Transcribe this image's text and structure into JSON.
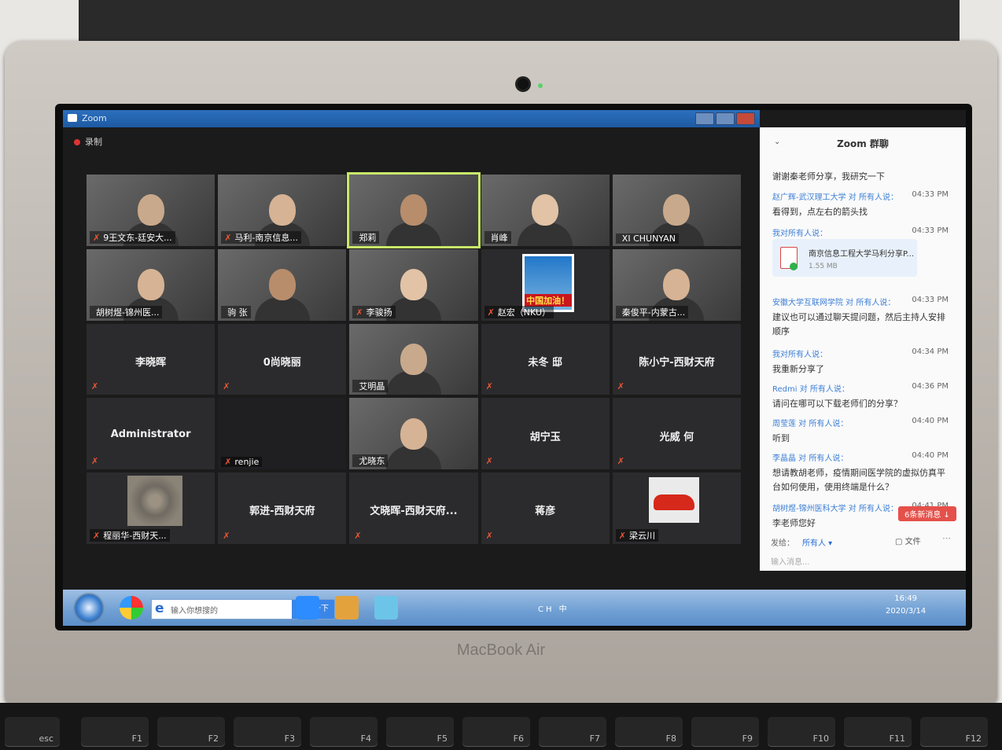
{
  "window": {
    "title": "Zoom",
    "record_label": "录制"
  },
  "participants": [
    {
      "name": "9王文东-廷安大...",
      "type": "video",
      "muted": true
    },
    {
      "name": "马利-南京信息...",
      "type": "video",
      "muted": true
    },
    {
      "name": "郑莉",
      "type": "video",
      "muted": false,
      "active": true
    },
    {
      "name": "肖峰",
      "type": "video",
      "muted": false
    },
    {
      "name": "XI CHUNYAN",
      "type": "video",
      "muted": false
    },
    {
      "name": "胡树煜-锦州医...",
      "type": "video",
      "muted": false
    },
    {
      "name": "驹 张",
      "type": "video",
      "muted": false
    },
    {
      "name": "李骏扬",
      "type": "video",
      "muted": true
    },
    {
      "name": "赵宏（NKU）",
      "type": "avatar-flag",
      "muted": true,
      "badge": "中国加油！"
    },
    {
      "name": "秦俊平-内蒙古...",
      "type": "video",
      "muted": false
    },
    {
      "name": "李晓晖",
      "type": "name",
      "muted": true
    },
    {
      "name": "0尚晓丽",
      "type": "name",
      "muted": true
    },
    {
      "name": "艾明晶",
      "type": "video",
      "muted": false
    },
    {
      "name": "未冬 邸",
      "type": "name",
      "muted": true
    },
    {
      "name": "陈小宁-西财天府",
      "type": "name",
      "muted": true
    },
    {
      "name": "Administrator",
      "type": "name",
      "muted": true
    },
    {
      "name": "renjie",
      "type": "video-dark",
      "muted": true
    },
    {
      "name": "尤晓东",
      "type": "video",
      "muted": false
    },
    {
      "name": "胡宁玉",
      "type": "name",
      "muted": true
    },
    {
      "name": "光威 何",
      "type": "name",
      "muted": true
    },
    {
      "name": "程丽华-西财天...",
      "type": "avatar-stones",
      "muted": true
    },
    {
      "name": "郭进-西财天府",
      "type": "name",
      "muted": true
    },
    {
      "name": "文晓晖-西财天府...",
      "type": "name",
      "muted": true
    },
    {
      "name": "蒋彦",
      "type": "name",
      "muted": true
    },
    {
      "name": "梁云川",
      "type": "avatar-car",
      "muted": true
    }
  ],
  "chat": {
    "title": "Zoom 群聊",
    "messages": [
      {
        "sender": "",
        "time": "",
        "text": "谢谢秦老师分享，我研究一下"
      },
      {
        "sender": "赵广辉-武汉理工大学 对 所有人说：",
        "time": "04:33 PM",
        "text": "看得到，点左右的箭头找"
      },
      {
        "sender": "我对所有人说：",
        "time": "04:33 PM",
        "text": ""
      },
      {
        "sender": "安徽大学互联网学院 对 所有人说：",
        "time": "04:33 PM",
        "text": "建议也可以通过聊天提问题，然后主持人安排顺序"
      },
      {
        "sender": "我对所有人说：",
        "time": "04:34 PM",
        "text": "我重新分享了"
      },
      {
        "sender": "Redmi 对 所有人说：",
        "time": "04:36 PM",
        "text": "请问在哪可以下载老师们的分享？"
      },
      {
        "sender": "周莹莲 对 所有人说：",
        "time": "04:40 PM",
        "text": "听到"
      },
      {
        "sender": "李晶晶 对 所有人说：",
        "time": "04:40 PM",
        "text": "想请教胡老师，疫情期间医学院的虚拟仿真平台如何使用，使用终端是什么？"
      },
      {
        "sender": "胡树煜-锦州医科大学 对 所有人说：",
        "time": "04:41 PM",
        "text": "李老师您好"
      }
    ],
    "file": {
      "name": "南京信息工程大学马利分享P...",
      "size": "1.55 MB"
    },
    "new_messages": "6条新消息 ↓",
    "send_to_label": "发给：",
    "send_to_value": "所有人 ▾",
    "file_button": "文件",
    "input_placeholder": "输入消息..."
  },
  "taskbar": {
    "search_placeholder": "输入你想搜的",
    "search_button": "搜索一下",
    "tray_text": "CH 中",
    "time": "16:49",
    "date": "2020/3/14"
  },
  "device": {
    "brand": "MacBook Air",
    "keys": [
      "esc",
      "F1",
      "F2",
      "F3",
      "F4",
      "F5",
      "F6",
      "F7",
      "F8",
      "F9",
      "F10",
      "F11",
      "F12"
    ]
  }
}
